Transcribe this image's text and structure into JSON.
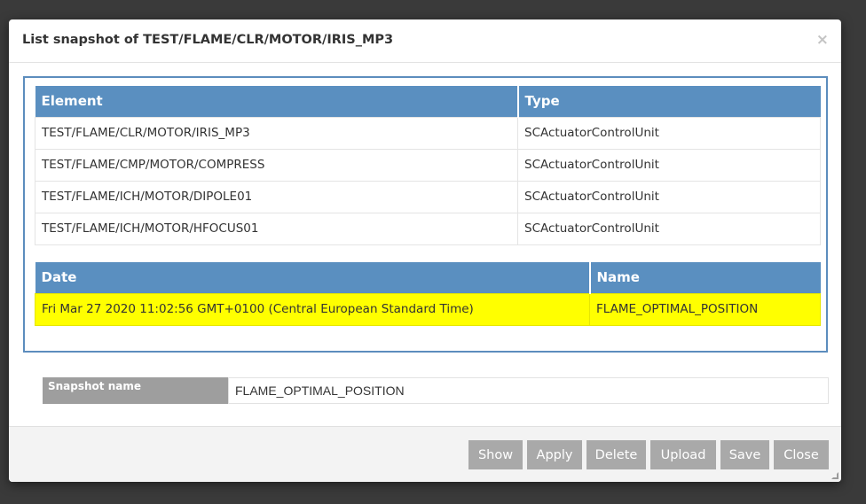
{
  "dialog": {
    "title": "List snapshot of TEST/FLAME/CLR/MOTOR/IRIS_MP3",
    "close_glyph": "×",
    "close_icon": "close-icon"
  },
  "elements_table": {
    "headers": [
      "Element",
      "Type"
    ],
    "rows": [
      [
        "TEST/FLAME/CLR/MOTOR/IRIS_MP3",
        "SCActuatorControlUnit"
      ],
      [
        "TEST/FLAME/CMP/MOTOR/COMPRESS",
        "SCActuatorControlUnit"
      ],
      [
        "TEST/FLAME/ICH/MOTOR/DIPOLE01",
        "SCActuatorControlUnit"
      ],
      [
        "TEST/FLAME/ICH/MOTOR/HFOCUS01",
        "SCActuatorControlUnit"
      ]
    ]
  },
  "snapshots_table": {
    "headers": [
      "Date",
      "Name"
    ],
    "rows": [
      [
        "Fri Mar 27 2020 11:02:56 GMT+0100 (Central European Standard Time)",
        "FLAME_OPTIMAL_POSITION"
      ]
    ],
    "selected_row": 0
  },
  "snapshot_name": {
    "label": "Snapshot name",
    "value": "FLAME_OPTIMAL_POSITION"
  },
  "footer": {
    "show_label": "Show",
    "apply_label": "Apply",
    "delete_label": "Delete",
    "upload_label": "Upload",
    "save_label": "Save",
    "close_label": "Close"
  },
  "colors": {
    "header_blue": "#5a8fc0",
    "frame_blue": "#5c8dbd",
    "selected_row": "#ffff00",
    "button_gray": "#a9a9a9",
    "label_gray": "#9e9e9e"
  }
}
